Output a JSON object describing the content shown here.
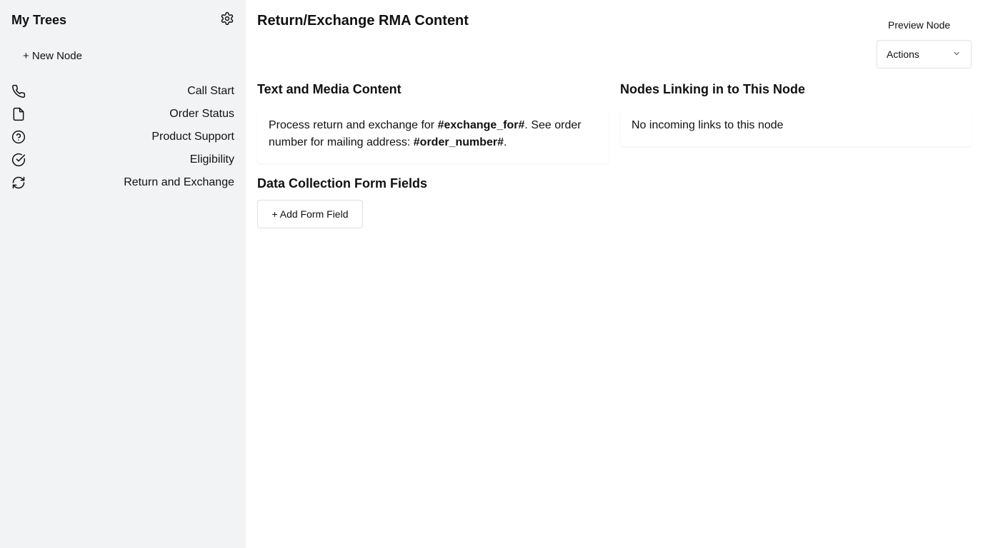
{
  "sidebar": {
    "title": "My Trees",
    "settings_icon": "gear-icon",
    "new_node_label": "+ New Node",
    "items": [
      {
        "label": "Call Start",
        "icon": "phone-icon"
      },
      {
        "label": "Order Status",
        "icon": "document-icon"
      },
      {
        "label": "Product Support",
        "icon": "question-circle-icon"
      },
      {
        "label": "Eligibility",
        "icon": "check-circle-icon"
      },
      {
        "label": "Return and Exchange",
        "icon": "refresh-icon"
      }
    ]
  },
  "header": {
    "title": "Return/Exchange RMA Content",
    "preview_label": "Preview Node",
    "actions_label": "Actions"
  },
  "content": {
    "heading": "Text and Media Content",
    "text_prefix": "Process return and exchange for ",
    "var_exchange": "#exchange_for#",
    "text_middle": ". See order number for mailing address: ",
    "var_order": "#order_number#",
    "text_suffix": "."
  },
  "incoming": {
    "heading": "Nodes Linking in to This Node",
    "empty_text": "No incoming links to this node"
  },
  "form_fields": {
    "heading": "Data Collection Form Fields",
    "add_label": "+ Add Form Field"
  }
}
